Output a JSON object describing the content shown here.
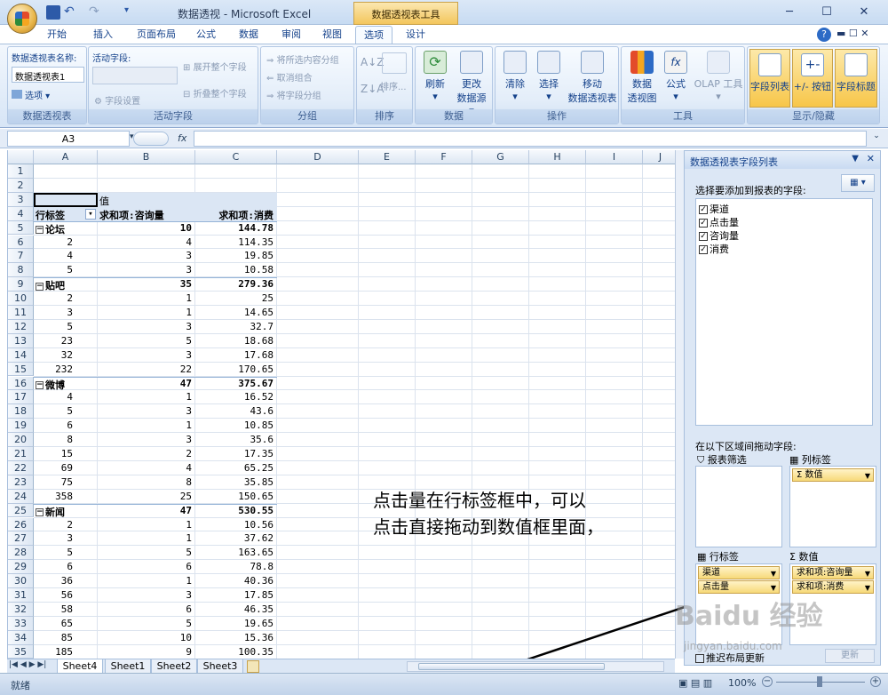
{
  "window": {
    "title": "数据透视 - Microsoft Excel",
    "context_tab": "数据透视表工具",
    "controls": [
      "─",
      "☐",
      "✕"
    ]
  },
  "ribbon": {
    "tabs": [
      "开始",
      "插入",
      "页面布局",
      "公式",
      "数据",
      "审阅",
      "视图",
      "选项",
      "设计"
    ],
    "active_tab": "选项",
    "groups": {
      "pivot_name": {
        "label": "数据透视表",
        "name_caption": "数据透视表名称:",
        "name_value": "数据透视表1",
        "options_btn": "选项"
      },
      "active_field": {
        "label": "活动字段",
        "caption": "活动字段:",
        "field_settings": "字段设置",
        "expand_all": "展开整个字段",
        "collapse_all": "折叠整个字段"
      },
      "group": {
        "label": "分组",
        "group_selection": "将所选内容分组",
        "ungroup": "取消组合",
        "group_field": "将字段分组"
      },
      "sort": {
        "label": "排序",
        "sort_btn": "排序..."
      },
      "data": {
        "label": "数据",
        "refresh": "刷新",
        "change_source_1": "更改",
        "change_source_2": "数据源"
      },
      "actions": {
        "label": "操作",
        "clear": "清除",
        "select": "选择",
        "move_1": "移动",
        "move_2": "数据透视表"
      },
      "tools": {
        "label": "工具",
        "pivot_chart_1": "数据",
        "pivot_chart_2": "透视图",
        "formulas": "公式",
        "olap": "OLAP 工具"
      },
      "show_hide": {
        "label": "显示/隐藏",
        "field_list": "字段列表",
        "buttons": "+/- 按钮",
        "headers": "字段标题"
      }
    }
  },
  "formula_bar": {
    "name_box": "A3",
    "fx": "fx",
    "content": ""
  },
  "sheet": {
    "columns": [
      "A",
      "B",
      "C",
      "D",
      "E",
      "F",
      "G",
      "H",
      "I",
      "J"
    ],
    "rows": [
      {
        "n": "1",
        "a": "",
        "b": "",
        "c": ""
      },
      {
        "n": "2",
        "a": "",
        "b": "",
        "c": ""
      },
      {
        "n": "3",
        "a": "",
        "b": "值",
        "c": ""
      },
      {
        "n": "4",
        "a": "行标签",
        "b": "求和项:咨询量",
        "c": "求和项:消费"
      },
      {
        "n": "5",
        "a": "论坛",
        "b": "10",
        "c": "144.78"
      },
      {
        "n": "6",
        "a": "2",
        "b": "4",
        "c": "114.35"
      },
      {
        "n": "7",
        "a": "4",
        "b": "3",
        "c": "19.85"
      },
      {
        "n": "8",
        "a": "5",
        "b": "3",
        "c": "10.58"
      },
      {
        "n": "9",
        "a": "贴吧",
        "b": "35",
        "c": "279.36"
      },
      {
        "n": "10",
        "a": "2",
        "b": "1",
        "c": "25"
      },
      {
        "n": "11",
        "a": "3",
        "b": "1",
        "c": "14.65"
      },
      {
        "n": "12",
        "a": "5",
        "b": "3",
        "c": "32.7"
      },
      {
        "n": "13",
        "a": "23",
        "b": "5",
        "c": "18.68"
      },
      {
        "n": "14",
        "a": "32",
        "b": "3",
        "c": "17.68"
      },
      {
        "n": "15",
        "a": "232",
        "b": "22",
        "c": "170.65"
      },
      {
        "n": "16",
        "a": "微博",
        "b": "47",
        "c": "375.67"
      },
      {
        "n": "17",
        "a": "4",
        "b": "1",
        "c": "16.52"
      },
      {
        "n": "18",
        "a": "5",
        "b": "3",
        "c": "43.6"
      },
      {
        "n": "19",
        "a": "6",
        "b": "1",
        "c": "10.85"
      },
      {
        "n": "20",
        "a": "8",
        "b": "3",
        "c": "35.6"
      },
      {
        "n": "21",
        "a": "15",
        "b": "2",
        "c": "17.35"
      },
      {
        "n": "22",
        "a": "69",
        "b": "4",
        "c": "65.25"
      },
      {
        "n": "23",
        "a": "75",
        "b": "8",
        "c": "35.85"
      },
      {
        "n": "24",
        "a": "358",
        "b": "25",
        "c": "150.65"
      },
      {
        "n": "25",
        "a": "新闻",
        "b": "47",
        "c": "530.55"
      },
      {
        "n": "26",
        "a": "2",
        "b": "1",
        "c": "10.56"
      },
      {
        "n": "27",
        "a": "3",
        "b": "1",
        "c": "37.62"
      },
      {
        "n": "28",
        "a": "5",
        "b": "5",
        "c": "163.65"
      },
      {
        "n": "29",
        "a": "6",
        "b": "6",
        "c": "78.8"
      },
      {
        "n": "30",
        "a": "36",
        "b": "1",
        "c": "40.36"
      },
      {
        "n": "31",
        "a": "56",
        "b": "3",
        "c": "17.85"
      },
      {
        "n": "32",
        "a": "58",
        "b": "6",
        "c": "46.35"
      },
      {
        "n": "33",
        "a": "65",
        "b": "5",
        "c": "19.65"
      },
      {
        "n": "34",
        "a": "85",
        "b": "10",
        "c": "15.36"
      },
      {
        "n": "35",
        "a": "185",
        "b": "9",
        "c": "100.35"
      }
    ],
    "tabs": [
      "Sheet4",
      "Sheet1",
      "Sheet2",
      "Sheet3"
    ],
    "active_sheet": "Sheet4"
  },
  "field_panel": {
    "title": "数据透视表字段列表",
    "choose_caption": "选择要添加到报表的字段:",
    "fields": [
      {
        "name": "渠道",
        "checked": true
      },
      {
        "name": "点击量",
        "checked": true
      },
      {
        "name": "咨询量",
        "checked": true
      },
      {
        "name": "消费",
        "checked": true
      }
    ],
    "drag_caption": "在以下区域间拖动字段:",
    "report_filter": "报表筛选",
    "column_labels": "列标签",
    "row_labels": "行标签",
    "values": "数值",
    "column_chips": [
      "Σ 数值"
    ],
    "row_chips": [
      "渠道",
      "点击量"
    ],
    "value_chips": [
      "求和项:咨询量",
      "求和项:消费"
    ],
    "defer_update": "推迟布局更新",
    "update_btn": "更新"
  },
  "status": {
    "ready": "就绪",
    "zoom": "100%"
  },
  "annotation": {
    "line1": "点击量在行标签框中，可以",
    "line2": "点击直接拖动到数值框里面，"
  },
  "watermark": {
    "text": "Baidu 经验",
    "url": "jingyan.baidu.com"
  },
  "colors": {
    "accent": "#f7c649",
    "ribbon": "#d7e5f6",
    "text": "#15428b"
  }
}
